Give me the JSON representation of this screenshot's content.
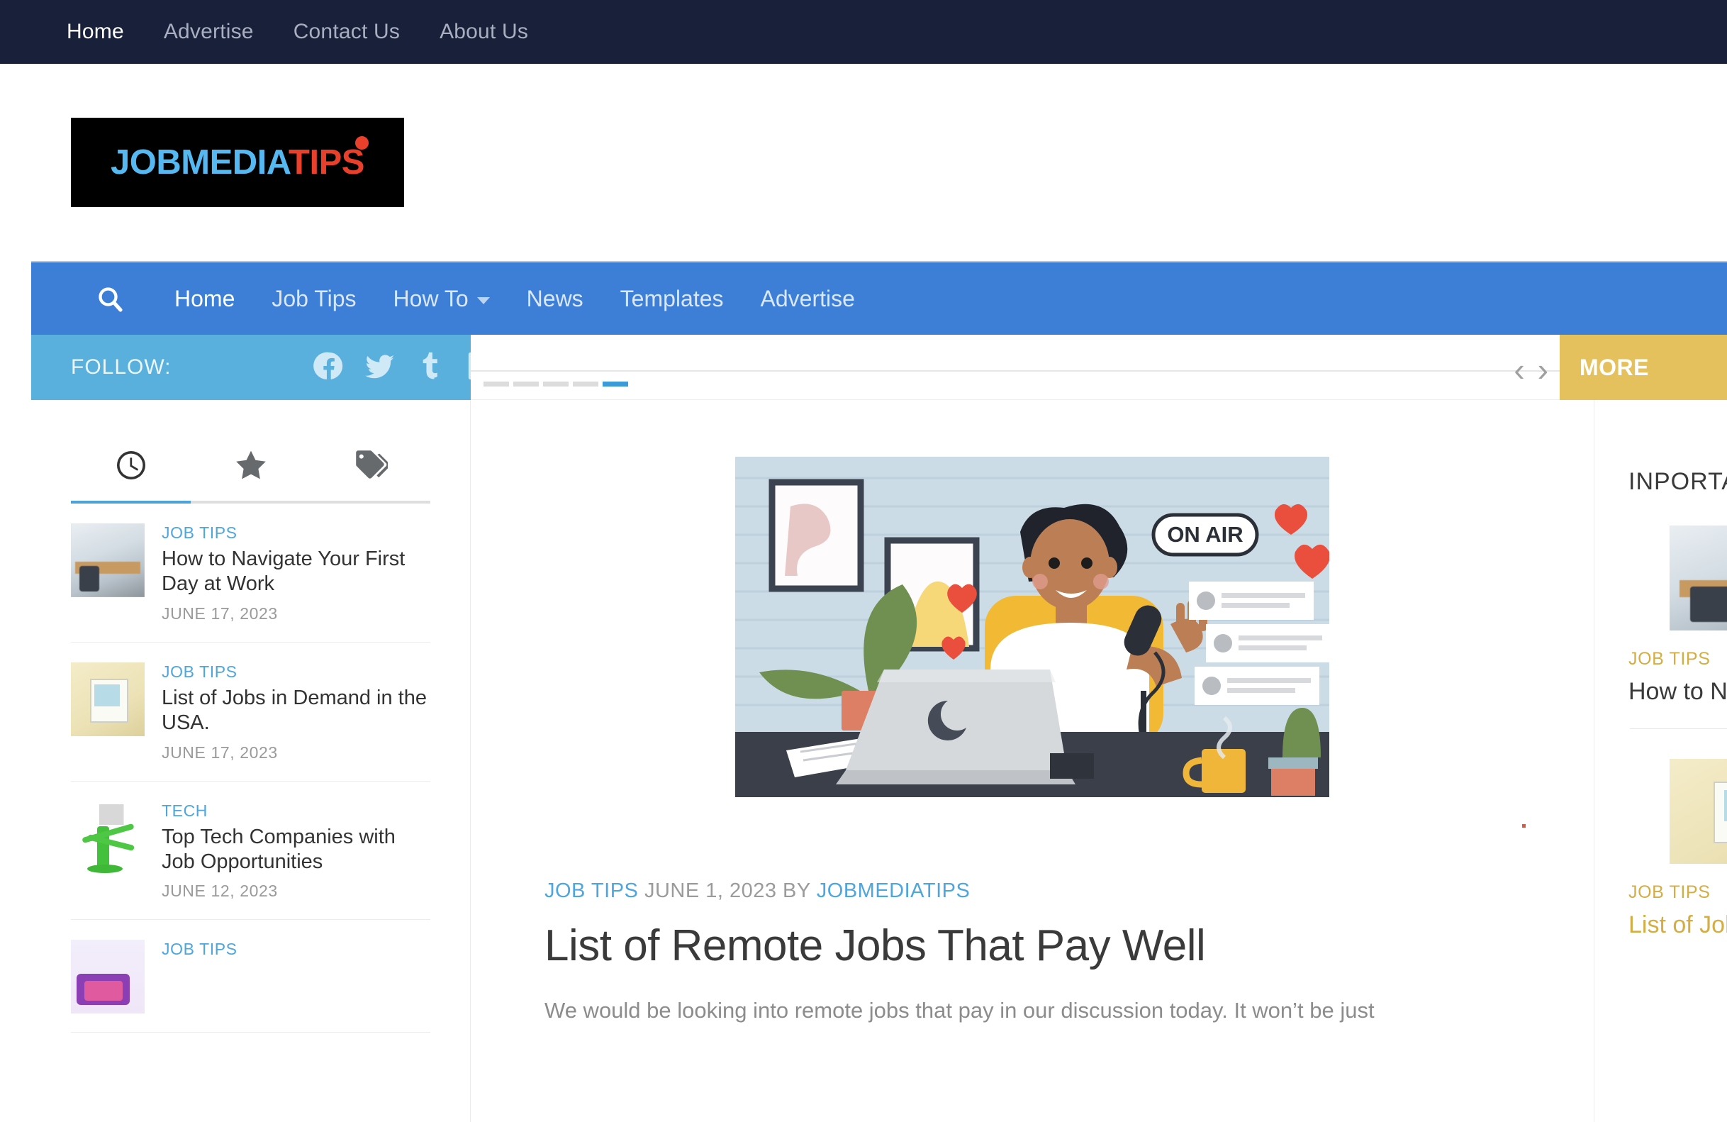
{
  "topbar": {
    "links": [
      {
        "label": "Home",
        "active": true
      },
      {
        "label": "Advertise",
        "active": false
      },
      {
        "label": "Contact Us",
        "active": false
      },
      {
        "label": "About Us",
        "active": false
      }
    ]
  },
  "logo": {
    "part_blue": "JOBMEDIA",
    "part_red": "TIPS",
    "blue_hex": "#55b8f0",
    "red_hex": "#e8402a",
    "background_hex": "#000000"
  },
  "mainnav": {
    "background_hex": "#3d7fd6",
    "search_icon": "search-icon",
    "links": [
      {
        "label": "Home",
        "active": true,
        "dropdown": false
      },
      {
        "label": "Job Tips",
        "active": false,
        "dropdown": false
      },
      {
        "label": "How To",
        "active": false,
        "dropdown": true
      },
      {
        "label": "News",
        "active": false,
        "dropdown": false
      },
      {
        "label": "Templates",
        "active": false,
        "dropdown": false
      },
      {
        "label": "Advertise",
        "active": false,
        "dropdown": false
      }
    ]
  },
  "followbar": {
    "label": "FOLLOW:",
    "background_hex": "#59b0dd",
    "socials": [
      {
        "name": "facebook-icon"
      },
      {
        "name": "twitter-icon"
      },
      {
        "name": "tumblr-icon"
      },
      {
        "name": "linkedin-icon"
      }
    ]
  },
  "carousel": {
    "prev_icon": "chevron-left-icon",
    "next_icon": "chevron-right-icon",
    "more_label": "MORE",
    "more_hex": "#e4c15d",
    "dashes": [
      {
        "active": false
      },
      {
        "active": false
      },
      {
        "active": false
      },
      {
        "active": false
      },
      {
        "active": true
      }
    ]
  },
  "sidebar": {
    "tabs": [
      {
        "icon": "clock-icon",
        "active": true
      },
      {
        "icon": "star-icon",
        "active": false
      },
      {
        "icon": "tags-icon",
        "active": false
      }
    ],
    "posts": [
      {
        "category": "JOB TIPS",
        "title": "How to Navigate Your First Day at Work",
        "date": "JUNE 17, 2023",
        "thumb": "office-workers-photo"
      },
      {
        "category": "JOB TIPS",
        "title": "List of Jobs in Demand in the USA.",
        "date": "JUNE 17, 2023",
        "thumb": "jobs-in-demand-notepad-photo"
      },
      {
        "category": "TECH",
        "title": "Top Tech Companies with Job Opportunities",
        "date": "JUNE 12, 2023",
        "thumb": "tech-logos-tree-photo"
      },
      {
        "category": "JOB TIPS",
        "title": "",
        "date": "",
        "thumb": "illustration-photo"
      }
    ]
  },
  "article": {
    "hero_alt": "podcaster-at-desk-on-air-illustration",
    "hero_labels": {
      "on_air": "ON AIR"
    },
    "category": "JOB TIPS",
    "date_by": "JUNE 1, 2023 BY",
    "author": "JOBMEDIATIPS",
    "title": "List of Remote Jobs That Pay Well",
    "excerpt": "We would be looking into remote jobs that pay in our discussion today. It won’t be just"
  },
  "rightbar": {
    "widget_title": "INPORTANT",
    "items": [
      {
        "category": "JOB TIPS",
        "title": "How to Navigate Your First Day at Work",
        "gold_title": false,
        "thumb": "office-workers-photo"
      },
      {
        "category": "JOB TIPS",
        "title": "List of Jobs in Demand in the USA.",
        "gold_title": true,
        "thumb": "jobs-in-demand-notepad-photo"
      }
    ]
  }
}
